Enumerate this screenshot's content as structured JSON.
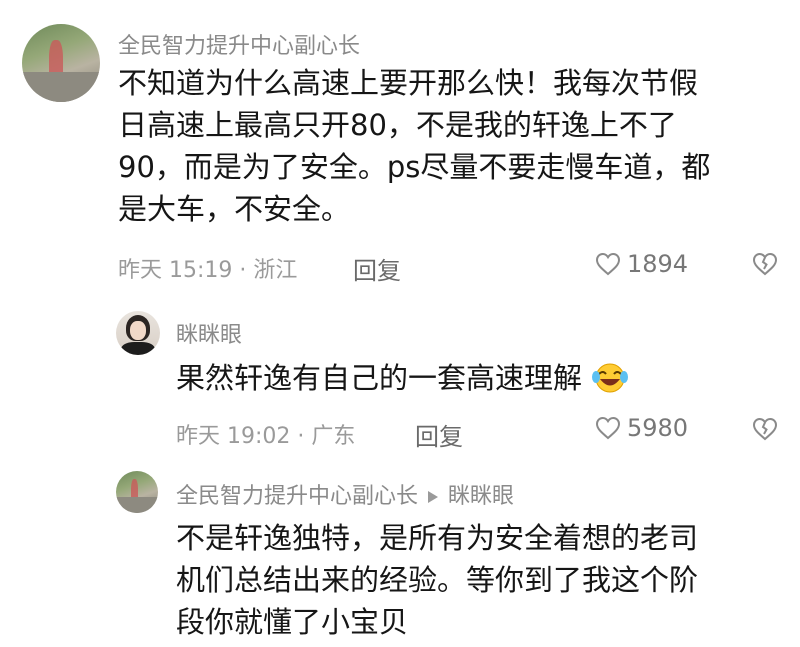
{
  "comment1": {
    "username": "全民智力提升中心副心长",
    "lines": [
      "不知道为什么高速上要开那么快！我每次节假",
      "日高速上最高只开80，不是我的轩逸上不了",
      "90，而是为了安全。ps尽量不要走慢车道，都",
      "是大车，不安全。"
    ],
    "meta": "昨天 15:19 · 浙江",
    "reply_label": "回复",
    "likes": "1894"
  },
  "reply1": {
    "username": "眯眯眼",
    "text": "果然轩逸有自己的一套高速理解",
    "meta": "昨天 19:02 · 广东",
    "reply_label": "回复",
    "likes": "5980"
  },
  "reply2": {
    "username": "全民智力提升中心副心长",
    "reply_to": "眯眯眼",
    "lines": [
      "不是轩逸独特，是所有为安全着想的老司",
      "机们总结出来的经验。等你到了我这个阶",
      "段你就懂了小宝贝"
    ]
  },
  "icons": {
    "like": "heart-outline-icon",
    "dislike": "broken-heart-icon",
    "emoji": "laughing-tears-emoji"
  }
}
